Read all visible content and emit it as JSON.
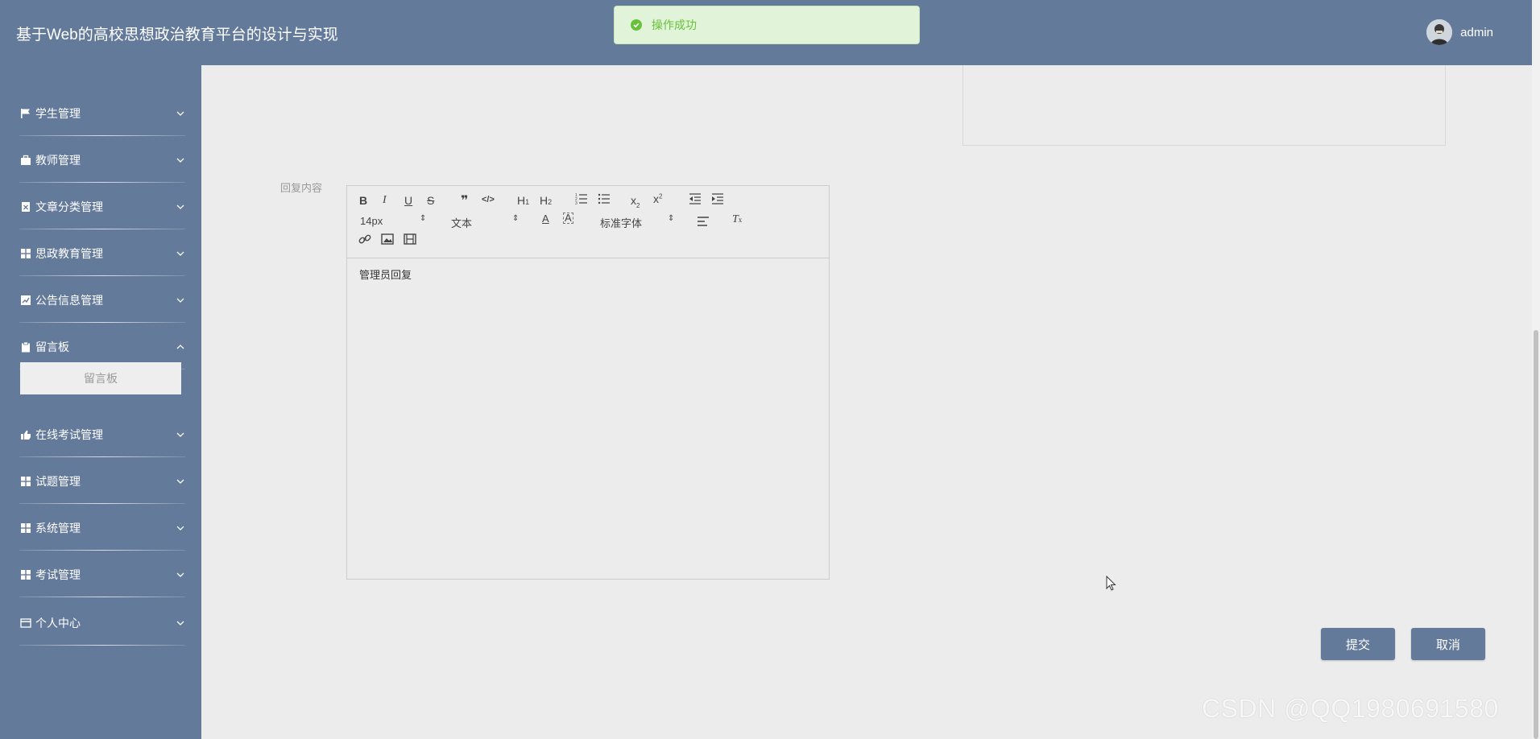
{
  "app": {
    "title": "基于Web的高校思想政治教育平台的设计与实现"
  },
  "user": {
    "name": "admin"
  },
  "toast": {
    "message": "操作成功"
  },
  "sidebar": {
    "items": [
      {
        "label": "学生管理",
        "icon": "flag-icon",
        "expanded": false
      },
      {
        "label": "教师管理",
        "icon": "briefcase-icon",
        "expanded": false
      },
      {
        "label": "文章分类管理",
        "icon": "document-x-icon",
        "expanded": false
      },
      {
        "label": "思政教育管理",
        "icon": "grid-icon",
        "expanded": false
      },
      {
        "label": "公告信息管理",
        "icon": "chart-icon",
        "expanded": false
      },
      {
        "label": "留言板",
        "icon": "clipboard-icon",
        "expanded": true
      },
      {
        "label": "在线考试管理",
        "icon": "thumbs-up-icon",
        "expanded": false
      },
      {
        "label": "试题管理",
        "icon": "grid-icon",
        "expanded": false
      },
      {
        "label": "系统管理",
        "icon": "grid-icon",
        "expanded": false
      },
      {
        "label": "考试管理",
        "icon": "grid-icon",
        "expanded": false
      },
      {
        "label": "个人中心",
        "icon": "card-icon",
        "expanded": false
      }
    ],
    "submenu": {
      "label": "留言板"
    }
  },
  "form": {
    "reply_label": "回复内容",
    "editor": {
      "font_size": "14px",
      "header_select": "文本",
      "font_family": "标准字体",
      "content": "管理员回复"
    }
  },
  "buttons": {
    "submit": "提交",
    "cancel": "取消"
  },
  "watermark": "CSDN @QQ1980691580",
  "colors": {
    "primary": "#647a9a",
    "success": "#67c23a",
    "background": "#ececec"
  }
}
